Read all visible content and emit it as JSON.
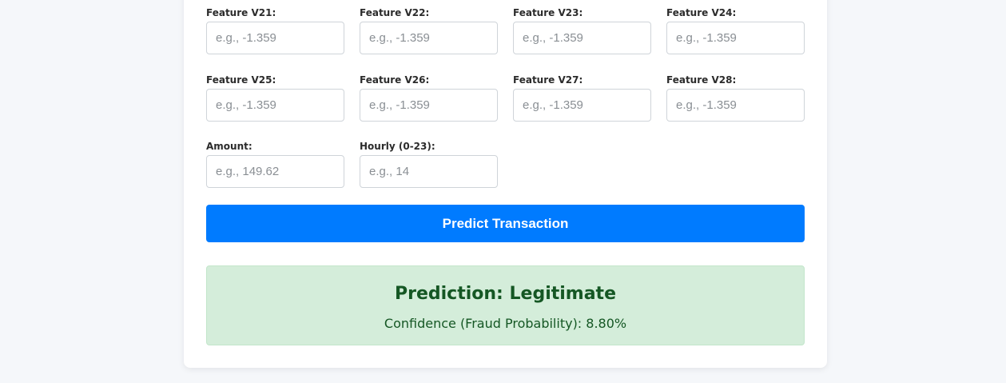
{
  "form": {
    "fields": [
      {
        "label": "Feature V21:",
        "placeholder": "e.g., -1.359"
      },
      {
        "label": "Feature V22:",
        "placeholder": "e.g., -1.359"
      },
      {
        "label": "Feature V23:",
        "placeholder": "e.g., -1.359"
      },
      {
        "label": "Feature V24:",
        "placeholder": "e.g., -1.359"
      },
      {
        "label": "Feature V25:",
        "placeholder": "e.g., -1.359"
      },
      {
        "label": "Feature V26:",
        "placeholder": "e.g., -1.359"
      },
      {
        "label": "Feature V27:",
        "placeholder": "e.g., -1.359"
      },
      {
        "label": "Feature V28:",
        "placeholder": "e.g., -1.359"
      },
      {
        "label": "Amount:",
        "placeholder": "e.g., 149.62"
      },
      {
        "label": "Hourly (0-23):",
        "placeholder": "e.g., 14"
      }
    ],
    "submit_label": "Predict Transaction"
  },
  "result": {
    "title": "Prediction: Legitimate",
    "confidence": "Confidence (Fraud Probability): 8.80%",
    "background_color": "#d4edda",
    "text_color": "#155724"
  },
  "colors": {
    "accent": "#007bff",
    "page_background": "#f5f7fa"
  }
}
